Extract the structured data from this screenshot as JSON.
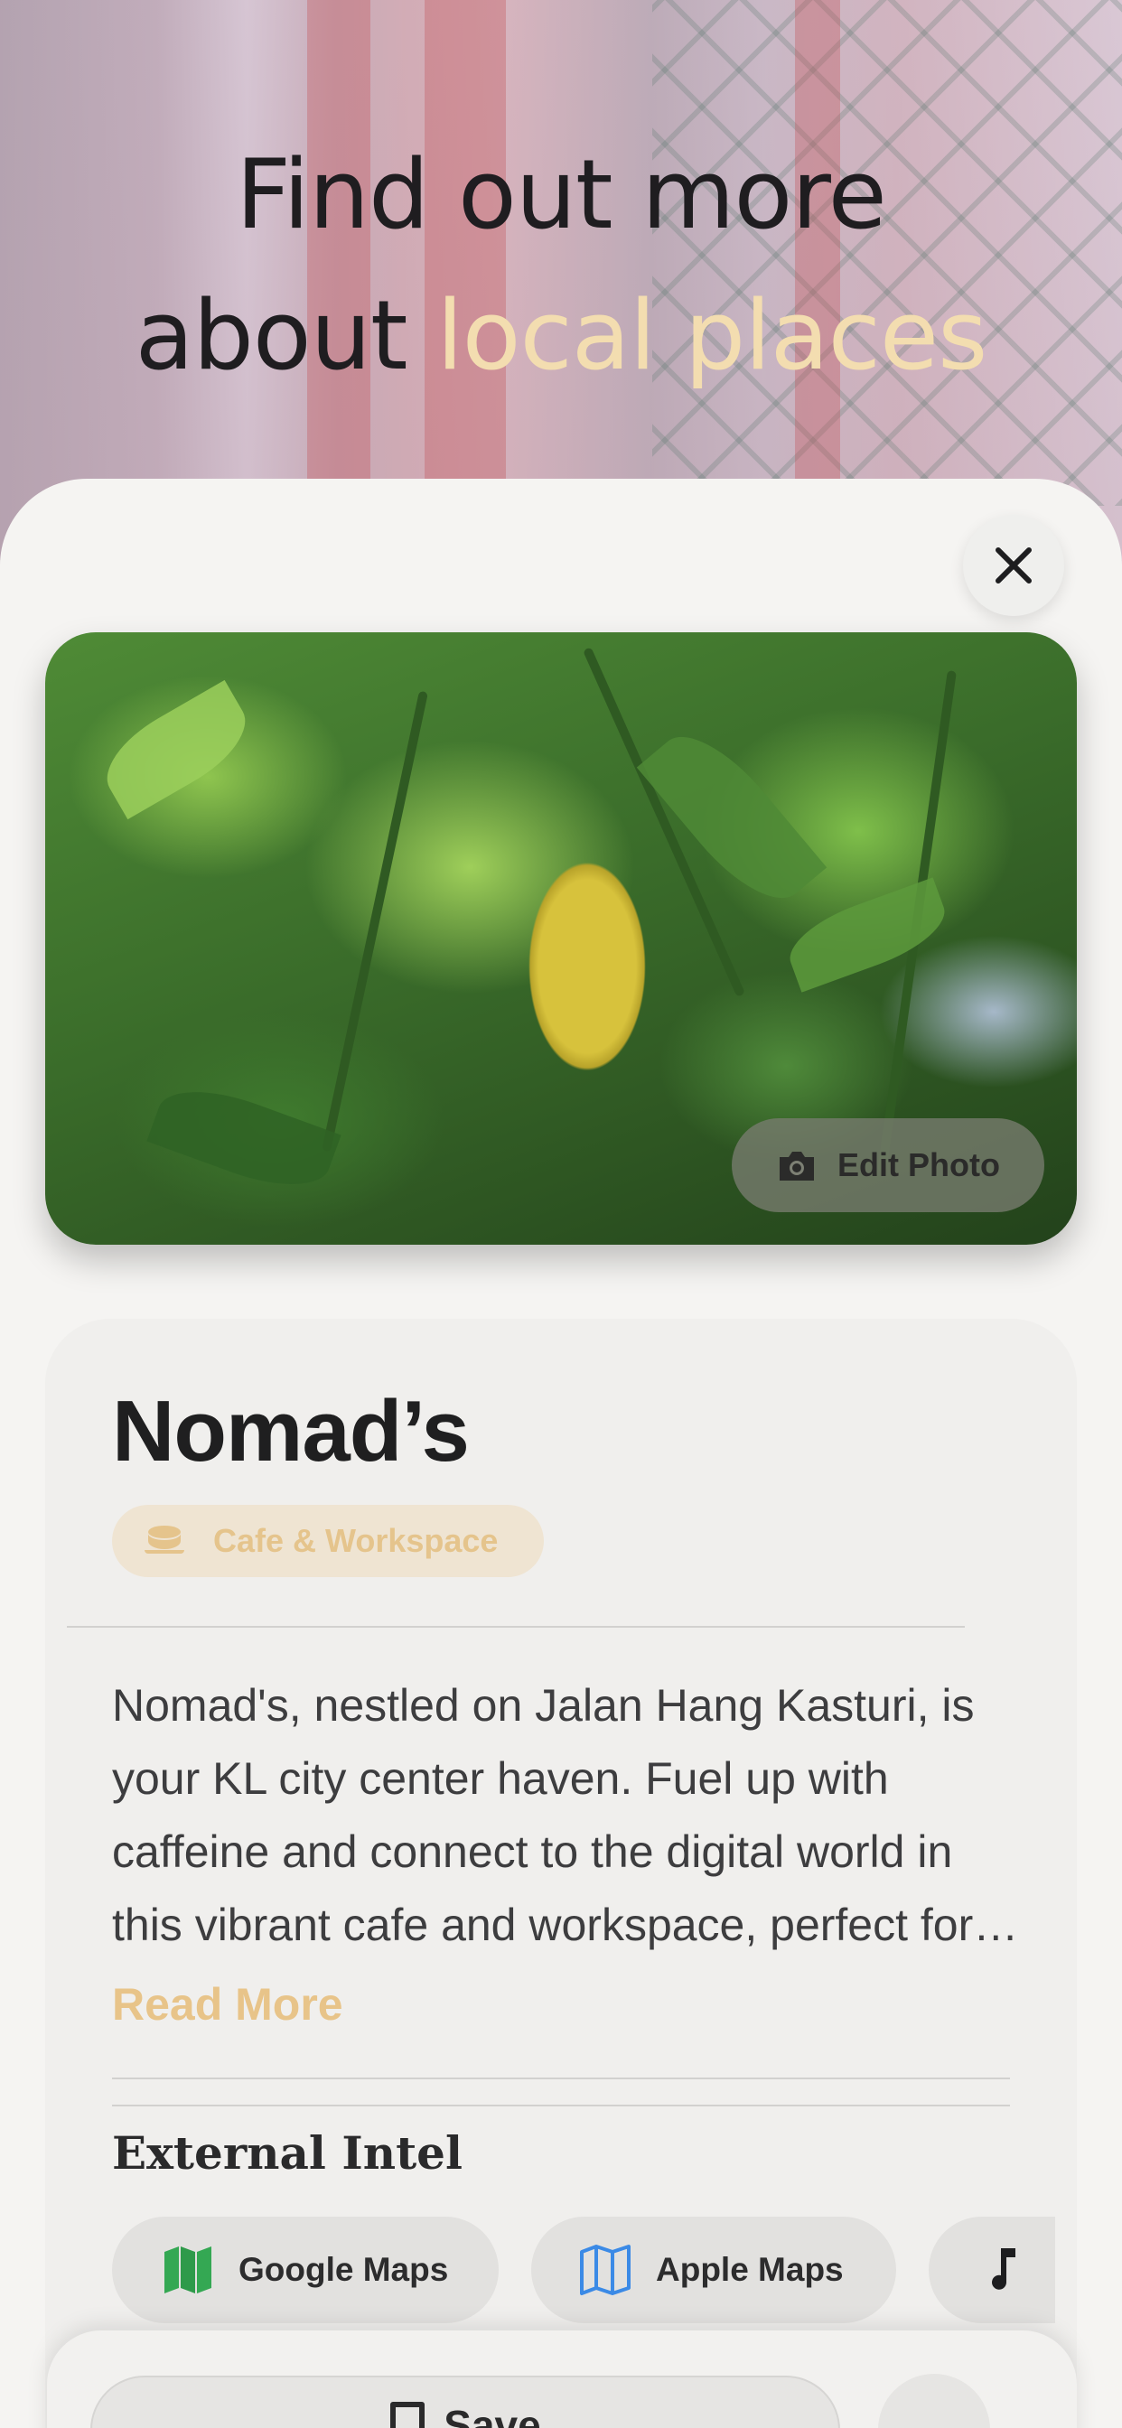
{
  "hero": {
    "title_line1": "Find out more",
    "title_line2_prefix": "about",
    "title_line2_accent": "local places"
  },
  "photo": {
    "edit_label": "Edit Photo"
  },
  "place": {
    "name": "Nomad’s",
    "category": "Cafe & Workspace",
    "description": "Nomad's, nestled on Jalan Hang Kasturi, is your KL city center haven. Fuel up with caffeine and connect to the digital world in this vibrant cafe and workspace, perfect for the modern nomad.",
    "read_more_label": "Read More"
  },
  "external_intel": {
    "title": "External Intel",
    "links": [
      {
        "label": "Google Maps",
        "icon": "google-maps-icon"
      },
      {
        "label": "Apple Maps",
        "icon": "apple-maps-icon"
      },
      {
        "label": "",
        "icon": "music-note-icon"
      }
    ]
  },
  "bottom_bar": {
    "save_label": "Save"
  },
  "colors": {
    "accent": "#e8c489",
    "sheet": "#f5f4f2",
    "google_maps_green": "#34a853",
    "apple_maps_blue": "#3b8ae6"
  }
}
